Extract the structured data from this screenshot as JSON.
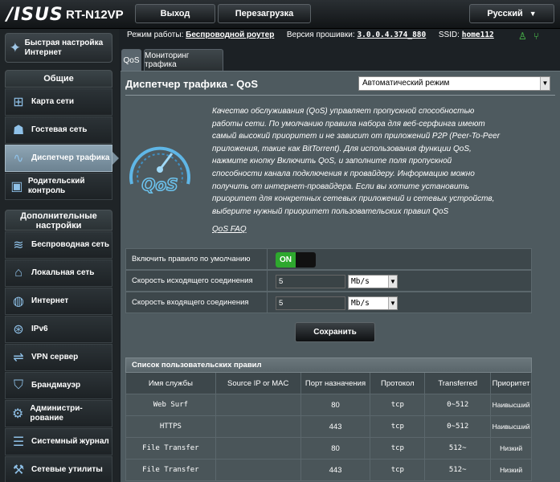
{
  "brand": {
    "logo": "/ISUS",
    "model": "RT-N12VP"
  },
  "top_buttons": {
    "logout": "Выход",
    "reboot": "Перезагрузка",
    "language": "Русский"
  },
  "info": {
    "mode_label": "Режим работы:",
    "mode_value": "Беспроводной роутер",
    "firmware_label": "Версия прошивки:",
    "firmware_value": "3.0.0.4.374_880",
    "ssid_label": "SSID:",
    "ssid_value": "home112"
  },
  "sidebar": {
    "quick_setup": "Быстрая настройка Интернет",
    "general_title": "Общие",
    "general_items": [
      {
        "label": "Карта сети",
        "icon": "network-map-icon"
      },
      {
        "label": "Гостевая сеть",
        "icon": "guest-network-icon"
      },
      {
        "label": "Диспетчер трафика",
        "icon": "traffic-manager-icon",
        "active": true
      },
      {
        "label": "Родительский контроль",
        "icon": "parental-control-icon"
      }
    ],
    "advanced_title": "Дополнительные настройки",
    "advanced_items": [
      {
        "label": "Беспроводная сеть",
        "icon": "wireless-icon"
      },
      {
        "label": "Локальная сеть",
        "icon": "lan-icon"
      },
      {
        "label": "Интернет",
        "icon": "internet-icon"
      },
      {
        "label": "IPv6",
        "icon": "ipv6-icon"
      },
      {
        "label": "VPN сервер",
        "icon": "vpn-icon"
      },
      {
        "label": "Брандмауэр",
        "icon": "firewall-icon"
      },
      {
        "label": "Администри-рование",
        "icon": "administration-icon"
      },
      {
        "label": "Системный журнал",
        "icon": "system-log-icon"
      },
      {
        "label": "Сетевые утилиты",
        "icon": "network-tools-icon"
      }
    ]
  },
  "tabs": {
    "qos": "QoS",
    "monitor": "Мониторинг трафика"
  },
  "main": {
    "title": "Диспетчер трафика - QoS",
    "mode_select": "Автоматический режим",
    "description": "Качество обслуживания (QoS) управляет пропускной способностью работы сети. По умолчанию правила набора для веб-серфинга имеют самый высокий приоритет и не зависит от приложений P2P (Peer-To-Peer приложения, такие как BitTorrent). Для использования функции QoS, нажмите кнопку Включить QoS, и заполните поля пропускной способности канала подключения к провайдеру. Информацию можно получить от интернет-провайдера. Если вы хотите установить приоритет для конкретных сетевых приложений и сетевых устройств, выберите нужный приоритет пользовательских правил QoS",
    "faq": "QoS FAQ",
    "default_rule_label": "Включить правило по умолчанию",
    "toggle_on": "ON",
    "upload_label": "Скорость исходящего соединения",
    "upload_value": "5",
    "upload_unit": "Mb/s",
    "download_label": "Скорость входящего соединения",
    "download_value": "5",
    "download_unit": "Mb/s",
    "apply": "Сохранить"
  },
  "rules": {
    "title": "Список пользовательских правил",
    "headers": [
      "Имя службы",
      "Source IP or MAC",
      "Порт назначения",
      "Протокол",
      "Transferred",
      "Приоритет"
    ],
    "rows": [
      [
        "Web Surf",
        "",
        "80",
        "tcp",
        "0~512",
        "Наивысший"
      ],
      [
        "HTTPS",
        "",
        "443",
        "tcp",
        "0~512",
        "Наивысший"
      ],
      [
        "File Transfer",
        "",
        "80",
        "tcp",
        "512~",
        "Низкий"
      ],
      [
        "File Transfer",
        "",
        "443",
        "tcp",
        "512~",
        "Низкий"
      ]
    ]
  },
  "colors": {
    "accent_active": "#7a8f9d",
    "toggle_on": "#2ea82e",
    "status_ok": "#4fd04f"
  }
}
